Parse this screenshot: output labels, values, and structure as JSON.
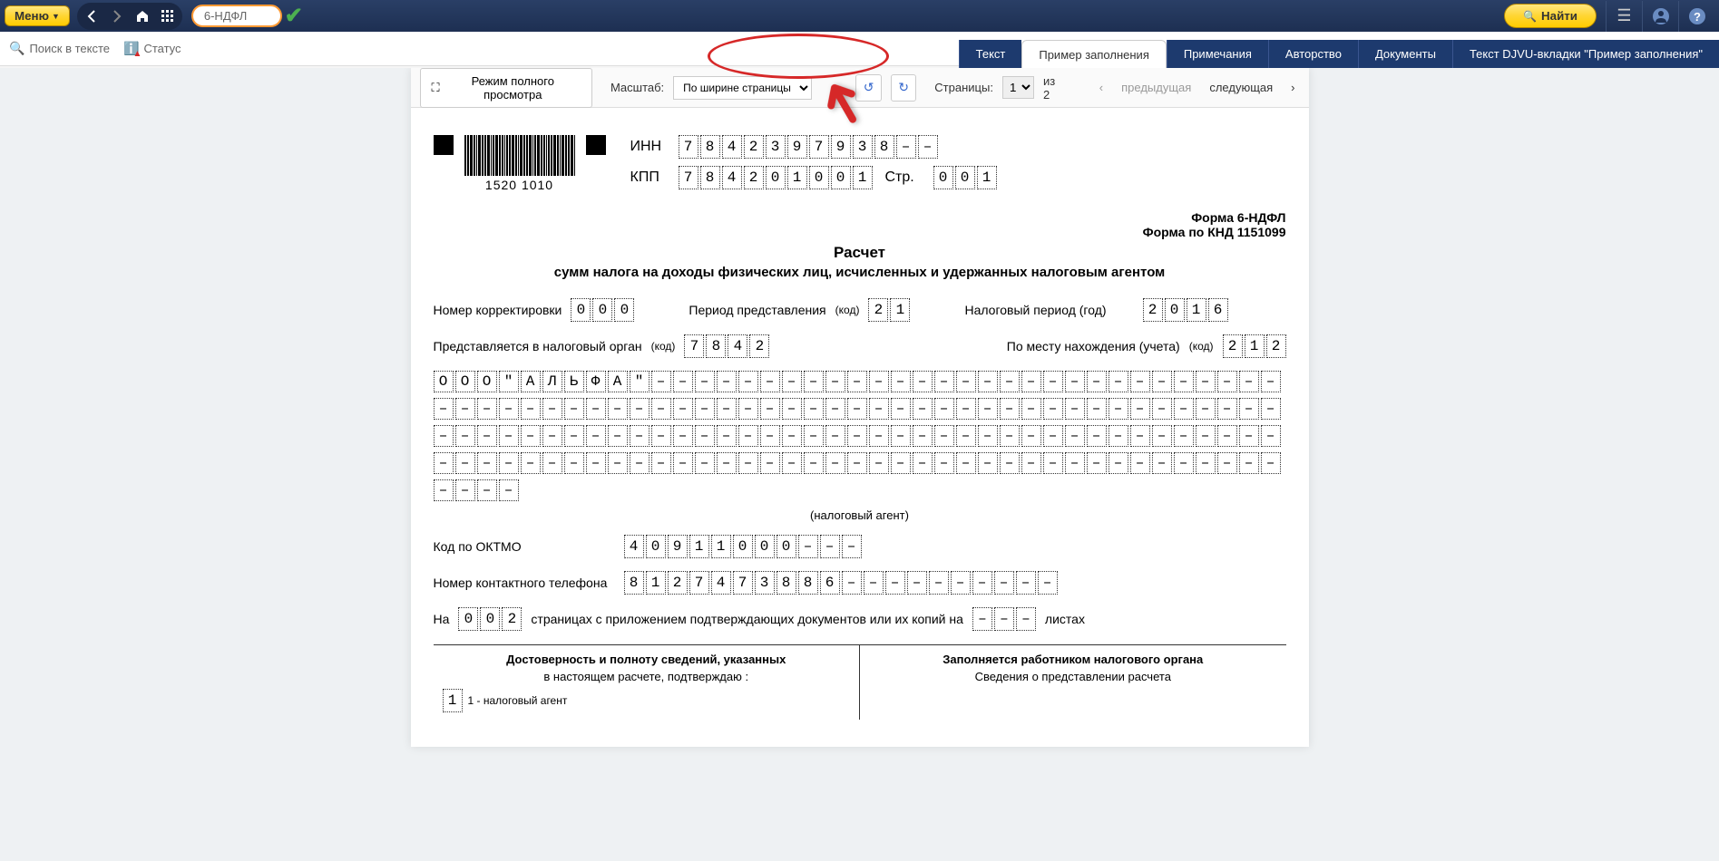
{
  "top": {
    "menu": "Меню",
    "searchPill": "6-НДФЛ",
    "find": "Найти"
  },
  "secondary": {
    "searchInText": "Поиск в тексте",
    "status": "Статус"
  },
  "tabs": {
    "text": "Текст",
    "example": "Пример заполнения",
    "notes": "Примечания",
    "authorship": "Авторство",
    "documents": "Документы",
    "djvu": "Текст DJVU-вкладки \"Пример заполнения\""
  },
  "viewerToolbar": {
    "fullView": "Режим полного просмотра",
    "scaleLabel": "Масштаб:",
    "scaleValue": "По ширине страницы",
    "pagesLabel": "Страницы:",
    "pageCurrent": "1",
    "pageOf": "из 2",
    "prev": "предыдущая",
    "next": "следующая"
  },
  "doc": {
    "barcodeText": "1520 1010",
    "innLabel": "ИНН",
    "inn": [
      "7",
      "8",
      "4",
      "2",
      "3",
      "9",
      "7",
      "9",
      "3",
      "8",
      "–",
      "–"
    ],
    "kppLabel": "КПП",
    "kpp": [
      "7",
      "8",
      "4",
      "2",
      "0",
      "1",
      "0",
      "0",
      "1"
    ],
    "pageLbl": "Стр.",
    "page": [
      "0",
      "0",
      "1"
    ],
    "formLine1": "Форма 6-НДФЛ",
    "formLine2": "Форма по КНД 1151099",
    "title": "Расчет",
    "subtitle": "сумм налога на доходы физических лиц, исчисленных и удержанных налоговым агентом",
    "corrLabel": "Номер корректировки",
    "corr": [
      "0",
      "0",
      "0"
    ],
    "periodLabel": "Период представления",
    "codeSuffix": "(код)",
    "period": [
      "2",
      "1"
    ],
    "taxYearLabel": "Налоговый период (год)",
    "taxYear": [
      "2",
      "0",
      "1",
      "6"
    ],
    "presentedLabel": "Представляется в налоговый орган",
    "presented": [
      "7",
      "8",
      "4",
      "2"
    ],
    "locationLabel": "По месту нахождения (учета)",
    "location": [
      "2",
      "1",
      "2"
    ],
    "orgName": [
      "О",
      "О",
      "О",
      "\"",
      "А",
      "Л",
      "Ь",
      "Ф",
      "А",
      "\"",
      "–",
      "–",
      "–",
      "–",
      "–",
      "–",
      "–",
      "–",
      "–",
      "–",
      "–",
      "–",
      "–",
      "–",
      "–",
      "–",
      "–",
      "–",
      "–",
      "–",
      "–",
      "–",
      "–",
      "–",
      "–",
      "–",
      "–",
      "–",
      "–",
      "–",
      "–",
      "–",
      "–",
      "–",
      "–",
      "–",
      "–",
      "–",
      "–",
      "–",
      "–",
      "–",
      "–",
      "–",
      "–",
      "–",
      "–",
      "–",
      "–",
      "–",
      "–",
      "–",
      "–",
      "–",
      "–",
      "–",
      "–",
      "–",
      "–",
      "–",
      "–",
      "–",
      "–",
      "–",
      "–",
      "–",
      "–",
      "–",
      "–",
      "–",
      "–",
      "–",
      "–",
      "–",
      "–",
      "–",
      "–",
      "–",
      "–",
      "–",
      "–",
      "–",
      "–",
      "–",
      "–",
      "–",
      "–",
      "–",
      "–",
      "–",
      "–",
      "–",
      "–",
      "–",
      "–",
      "–",
      "–",
      "–",
      "–",
      "–",
      "–",
      "–",
      "–",
      "–",
      "–",
      "–",
      "–",
      "–",
      "–",
      "–",
      "–",
      "–",
      "–",
      "–",
      "–",
      "–",
      "–",
      "–",
      "–",
      "–",
      "–",
      "–",
      "–",
      "–",
      "–",
      "–",
      "–",
      "–",
      "–",
      "–",
      "–",
      "–",
      "–",
      "–",
      "–",
      "–",
      "–",
      "–",
      "–",
      "–",
      "–",
      "–",
      "–",
      "–",
      "–",
      "–",
      "–",
      "–",
      "–",
      "–"
    ],
    "agentHint": "(налоговый агент)",
    "oktmoLabel": "Код по ОКТМО",
    "oktmo": [
      "4",
      "0",
      "9",
      "1",
      "1",
      "0",
      "0",
      "0",
      "–",
      "–",
      "–"
    ],
    "phoneLabel": "Номер контактного телефона",
    "phone": [
      "8",
      "1",
      "2",
      "7",
      "4",
      "7",
      "3",
      "8",
      "8",
      "6",
      "–",
      "–",
      "–",
      "–",
      "–",
      "–",
      "–",
      "–",
      "–",
      "–"
    ],
    "onLabel": "На",
    "pagesCount": [
      "0",
      "0",
      "2"
    ],
    "onText1": "страницах с приложением подтверждающих документов или их копий на",
    "attach": [
      "–",
      "–",
      "–"
    ],
    "onText2": "листах",
    "leftColTitle": "Достоверность и полноту сведений, указанных",
    "leftColSub": "в настоящем расчете, подтверждаю :",
    "agentType": [
      "1"
    ],
    "agentTypeLabel": "1 - налоговый агент",
    "rightColTitle": "Заполняется работником налогового органа",
    "rightColSub": "Сведения о представлении расчета"
  }
}
